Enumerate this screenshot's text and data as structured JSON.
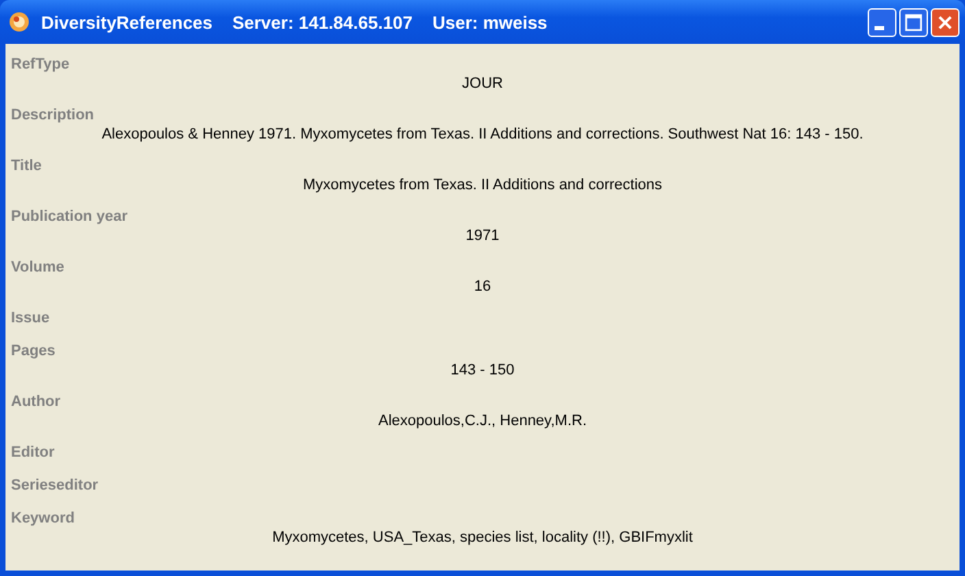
{
  "window": {
    "title": "DiversityReferences    Server: 141.84.65.107    User: mweiss"
  },
  "fields": [
    {
      "label": "RefType",
      "value": "JOUR"
    },
    {
      "label": "Description",
      "value": "Alexopoulos & Henney 1971. Myxomycetes from Texas. II Additions and corrections. Southwest Nat 16: 143 - 150."
    },
    {
      "label": "Title",
      "value": "Myxomycetes from Texas. II Additions and corrections"
    },
    {
      "label": "Publication year",
      "value": "1971"
    },
    {
      "label": "Volume",
      "value": "16"
    },
    {
      "label": "Issue"
    },
    {
      "label": "Pages",
      "value": "143 - 150"
    },
    {
      "label": "Author",
      "value": "Alexopoulos,C.J., Henney,M.R."
    },
    {
      "label": "Editor"
    },
    {
      "label": "Serieseditor"
    },
    {
      "label": "Keyword",
      "value": "Myxomycetes, USA_Texas, species list, locality (!!), GBIFmyxlit"
    }
  ]
}
